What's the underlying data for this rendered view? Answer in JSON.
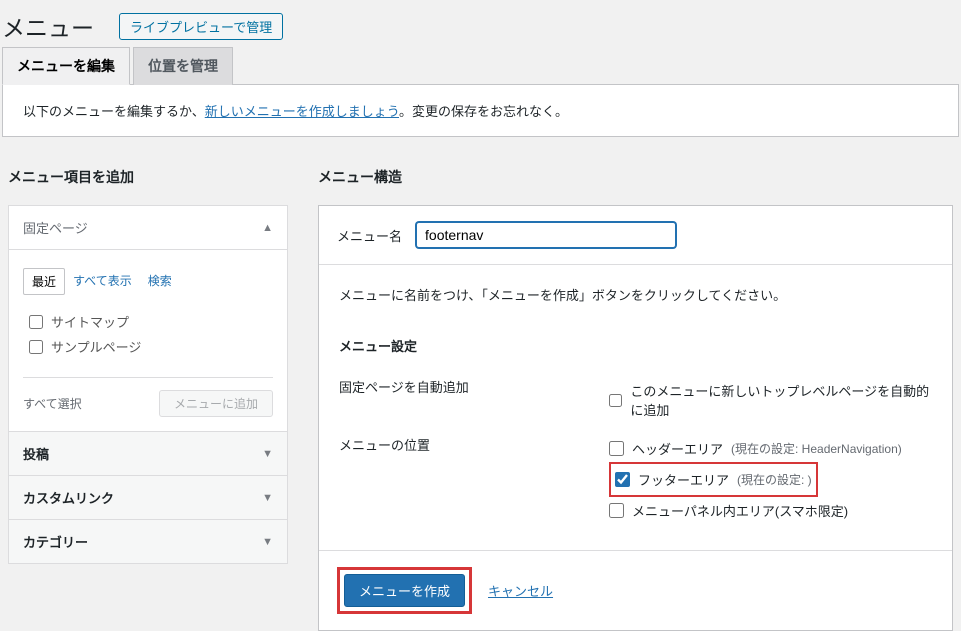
{
  "header": {
    "title": "メニュー",
    "live_preview_btn": "ライブプレビューで管理"
  },
  "tabs": {
    "edit_menus": "メニューを編集",
    "manage_locations": "位置を管理"
  },
  "info_bar": {
    "prefix": "以下のメニューを編集するか、",
    "link": "新しいメニューを作成しましょう",
    "suffix": "。変更の保存をお忘れなく。"
  },
  "left": {
    "title": "メニュー項目を追加",
    "panels": {
      "pages": "固定ページ",
      "posts": "投稿",
      "custom_links": "カスタムリンク",
      "categories": "カテゴリー"
    },
    "sub_tabs": {
      "recent": "最近",
      "all": "すべて表示",
      "search": "検索"
    },
    "items": {
      "sitemap": "サイトマップ",
      "sample": "サンプルページ"
    },
    "select_all": "すべて選択",
    "add_to_menu": "メニューに追加"
  },
  "right": {
    "title": "メニュー構造",
    "menu_name_label": "メニュー名",
    "menu_name_value": "footernav",
    "instruction": "メニューに名前をつけ、「メニューを作成」ボタンをクリックしてください。",
    "settings_title": "メニュー設定",
    "auto_add_label": "固定ページを自動追加",
    "auto_add_text": "このメニューに新しいトップレベルページを自動的に追加",
    "location_label": "メニューの位置",
    "locations": {
      "header": {
        "label": "ヘッダーエリア",
        "note": "(現在の設定: HeaderNavigation)"
      },
      "footer": {
        "label": "フッターエリア",
        "note": "(現在の設定: )"
      },
      "panel": {
        "label": "メニューパネル内エリア(スマホ限定)"
      }
    },
    "create_btn": "メニューを作成",
    "cancel_link": "キャンセル"
  }
}
